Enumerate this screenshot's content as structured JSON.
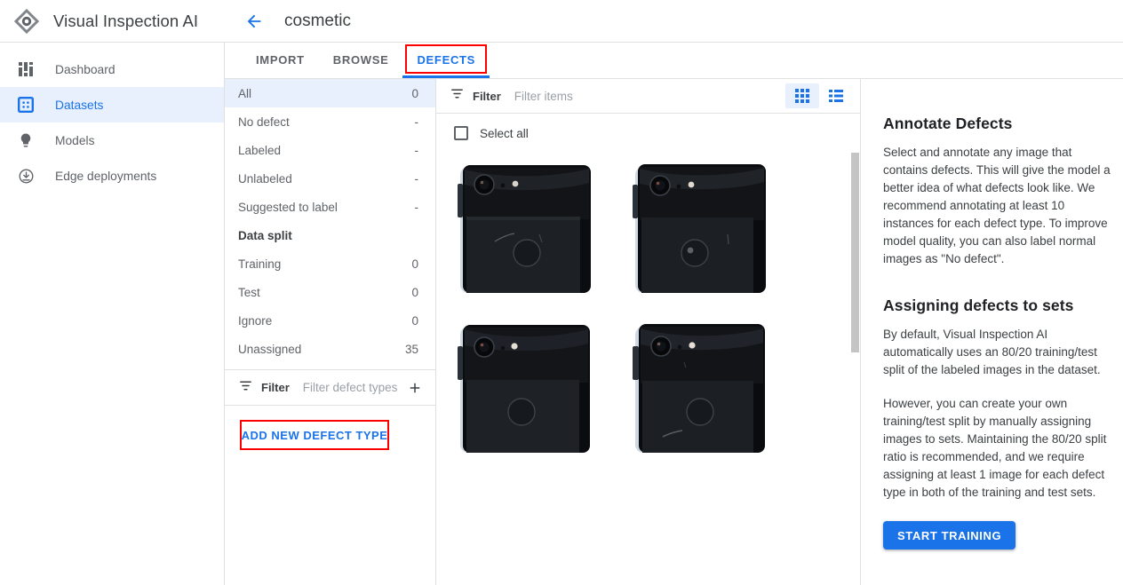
{
  "brand": {
    "title": "Visual Inspection AI",
    "logo_icon": "vision-diamond-eye-icon"
  },
  "header": {
    "back_icon": "arrow-back-icon",
    "dataset_title": "cosmetic"
  },
  "sidebar": {
    "items": [
      {
        "label": "Dashboard",
        "icon": "dashboard-icon",
        "active": false
      },
      {
        "label": "Datasets",
        "icon": "datasets-icon",
        "active": true
      },
      {
        "label": "Models",
        "icon": "lightbulb-icon",
        "active": false
      },
      {
        "label": "Edge deployments",
        "icon": "download-circle-icon",
        "active": false
      }
    ]
  },
  "tabs": [
    {
      "label": "IMPORT",
      "active": false,
      "highlighted": false
    },
    {
      "label": "BROWSE",
      "active": false,
      "highlighted": false
    },
    {
      "label": "DEFECTS",
      "active": true,
      "highlighted": true
    }
  ],
  "defect_panel": {
    "rows": [
      {
        "label": "All",
        "count": "0",
        "selected": true
      },
      {
        "label": "No defect",
        "count": "-",
        "selected": false
      },
      {
        "label": "Labeled",
        "count": "-",
        "selected": false
      },
      {
        "label": "Unlabeled",
        "count": "-",
        "selected": false
      },
      {
        "label": "Suggested to label",
        "count": "-",
        "selected": false
      }
    ],
    "section_title": "Data split",
    "split_rows": [
      {
        "label": "Training",
        "count": "0"
      },
      {
        "label": "Test",
        "count": "0"
      },
      {
        "label": "Ignore",
        "count": "0"
      },
      {
        "label": "Unassigned",
        "count": "35"
      }
    ],
    "filter_icon": "filter-list-icon",
    "filter_word": "Filter",
    "filter_placeholder": "Filter defect types",
    "filter_value": "",
    "add_icon": "plus-icon",
    "add_defect_label": "ADD NEW DEFECT TYPE"
  },
  "browser": {
    "filter_icon": "filter-list-icon",
    "filter_word": "Filter",
    "filter_placeholder": "Filter items",
    "filter_value": "",
    "grid_view_icon": "grid-view-icon",
    "list_view_icon": "list-view-icon",
    "active_view": "grid",
    "select_all_label": "Select all",
    "select_all_checked": false,
    "thumbnails": [
      {
        "alt": "phone-back-photo-1"
      },
      {
        "alt": "phone-back-photo-2"
      },
      {
        "alt": "phone-back-photo-3"
      },
      {
        "alt": "phone-back-photo-4"
      }
    ]
  },
  "info": {
    "heading1": "Annotate Defects",
    "paragraph1": "Select and annotate any image that contains defects. This will give the model a better idea of what defects look like. We recommend annotating at least 10 instances for each defect type. To improve model quality, you can also label normal images as \"No defect\".",
    "heading2": "Assigning defects to sets",
    "paragraph2": "By default, Visual Inspection AI automatically uses an 80/20 training/test split of the labeled images in the dataset.",
    "paragraph3": "However, you can create your own training/test split by manually assigning images to sets. Maintaining the 80/20 split ratio is recommended, and we require assigning at least 1 image for each defect type in both of the training and test sets.",
    "start_training_label": "START TRAINING"
  },
  "colors": {
    "accent_blue": "#1a73e8",
    "accent_blue_light": "#e8f0fe",
    "highlight_red": "#ff0000",
    "text_primary": "#3c4043",
    "text_secondary": "#5f6368",
    "border": "#e0e0e0"
  }
}
